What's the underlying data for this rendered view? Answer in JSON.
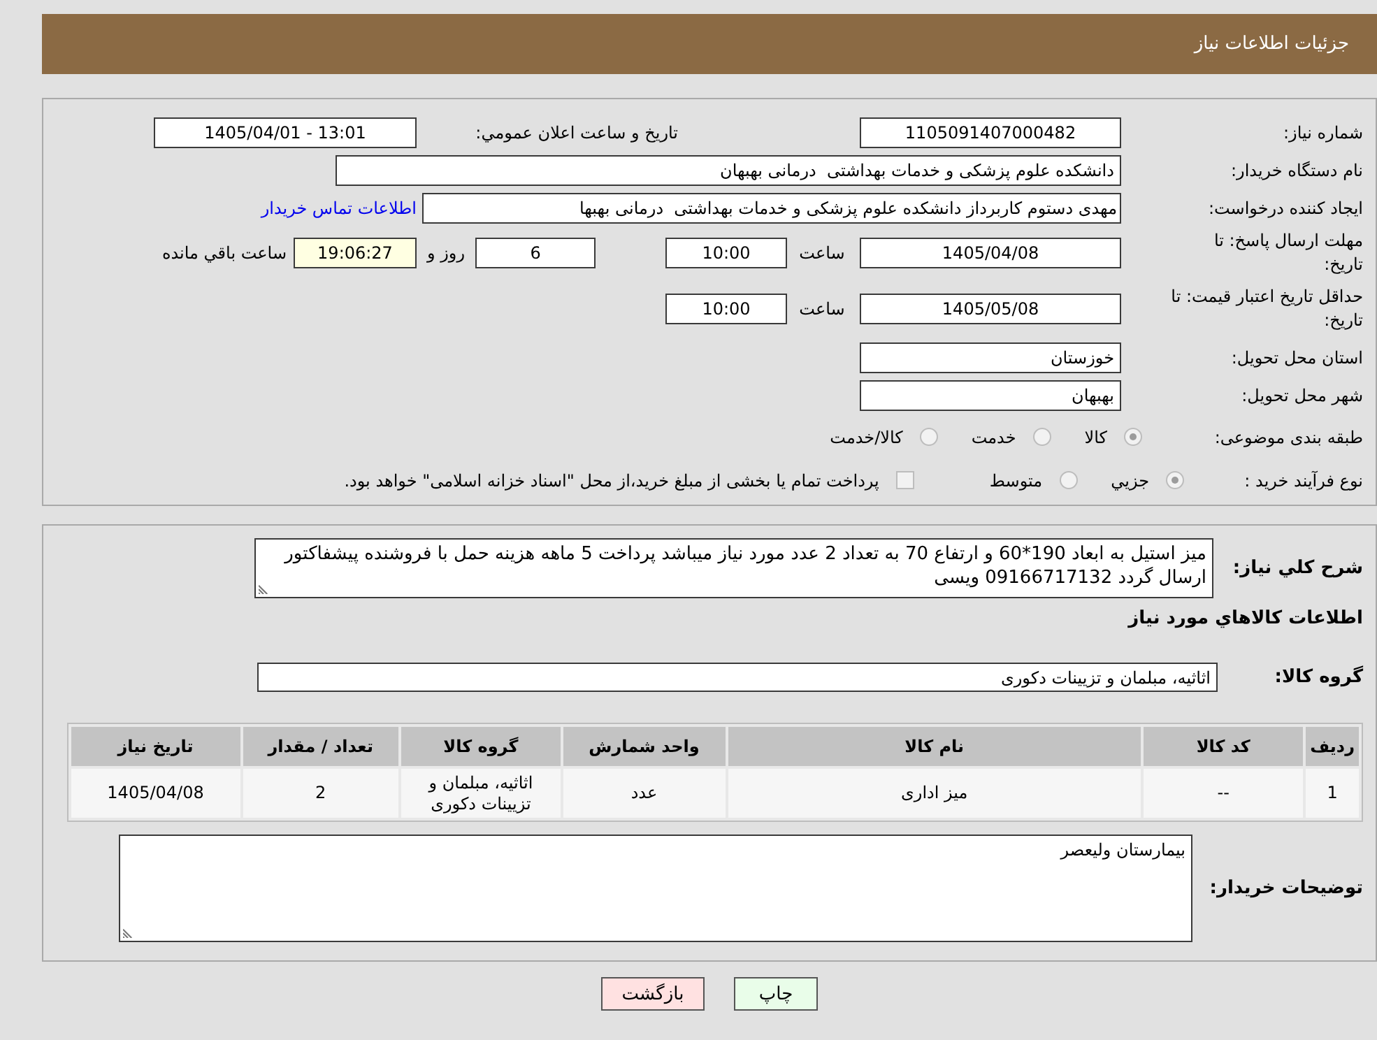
{
  "header": {
    "title": "جزئیات اطلاعات نیاز"
  },
  "details": {
    "need_number": {
      "label": "شماره نیاز:",
      "value": "1105091407000482"
    },
    "announce_date": {
      "label": "تاريخ و ساعت اعلان عمومي:",
      "value": "13:01 - 1405/04/01"
    },
    "buyer_org": {
      "label": "نام دستگاه خریدار:",
      "value": "دانشکده علوم پزشکی و خدمات بهداشتی  درمانی بهبهان"
    },
    "requester": {
      "label": "ایجاد کننده درخواست:",
      "value": "مهدی دستوم کاربرداز دانشکده علوم پزشکی و خدمات بهداشتی  درمانی بهبها",
      "link": "اطلاعات تماس خریدار"
    },
    "response_deadline": {
      "label": "مهلت ارسال پاسخ: تا تاریخ:",
      "date": "1405/04/08",
      "time_label": "ساعت",
      "time": "10:00",
      "days": "6",
      "days_label": "روز و",
      "remaining": "19:06:27",
      "remaining_label": "ساعت باقي مانده"
    },
    "price_validity": {
      "label": "حداقل تاریخ اعتبار قیمت: تا تاریخ:",
      "date": "1405/05/08",
      "time_label": "ساعت",
      "time": "10:00"
    },
    "delivery_province": {
      "label": "استان محل تحویل:",
      "value": "خوزستان"
    },
    "delivery_city": {
      "label": "شهر محل تحویل:",
      "value": "بهبهان"
    },
    "classification": {
      "label": "طبقه بندی موضوعی:",
      "options": [
        {
          "kind": "radio",
          "label": "کالا",
          "selected": true,
          "disabled": true
        },
        {
          "kind": "radio",
          "label": "خدمت",
          "selected": false,
          "disabled": true
        },
        {
          "kind": "radio",
          "label": "کالا/خدمت",
          "selected": false,
          "disabled": true
        }
      ]
    },
    "purchase_process": {
      "label": "نوع فرآیند خرید :",
      "options": [
        {
          "kind": "radio",
          "label": "جزيي",
          "selected": true,
          "disabled": true
        },
        {
          "kind": "radio",
          "label": "متوسط",
          "selected": false,
          "disabled": true
        },
        {
          "kind": "checkbox",
          "label": "پرداخت تمام یا بخشی از مبلغ خرید،از محل \"اسناد خزانه اسلامی\" خواهد بود.",
          "checked": false,
          "disabled": true
        }
      ]
    }
  },
  "need": {
    "description": {
      "label": "شرح کلي نياز:",
      "value": "میز استیل به ابعاد 190*60 و ارتفاع 70 به تعداد 2 عدد مورد نیاز میباشد پرداخت 5 ماهه هزینه حمل با فروشنده پیشفاکتور ارسال گردد 09166717132 ویسی"
    },
    "items_title": "اطلاعات کالاهاي مورد نياز",
    "goods_group": {
      "label": "گروه کالا:",
      "value": "اثاثیه، مبلمان و تزیینات دکوری"
    },
    "table": {
      "columns": [
        "ردیف",
        "کد کالا",
        "نام کالا",
        "واحد شمارش",
        "گروه کالا",
        "تعداد / مقدار",
        "تاریخ نیاز"
      ],
      "rows": [
        [
          "1",
          "--",
          "میز اداری",
          "عدد",
          "اثاثیه، مبلمان و تزیینات دکوری",
          "2",
          "1405/04/08"
        ]
      ]
    },
    "buyer_notes": {
      "label": "توضیحات خریدار:",
      "value": "بیمارستان ولیعصر"
    }
  },
  "buttons": [
    {
      "kind": "print",
      "label": "چاپ"
    },
    {
      "kind": "back",
      "label": "بازگشت"
    }
  ]
}
